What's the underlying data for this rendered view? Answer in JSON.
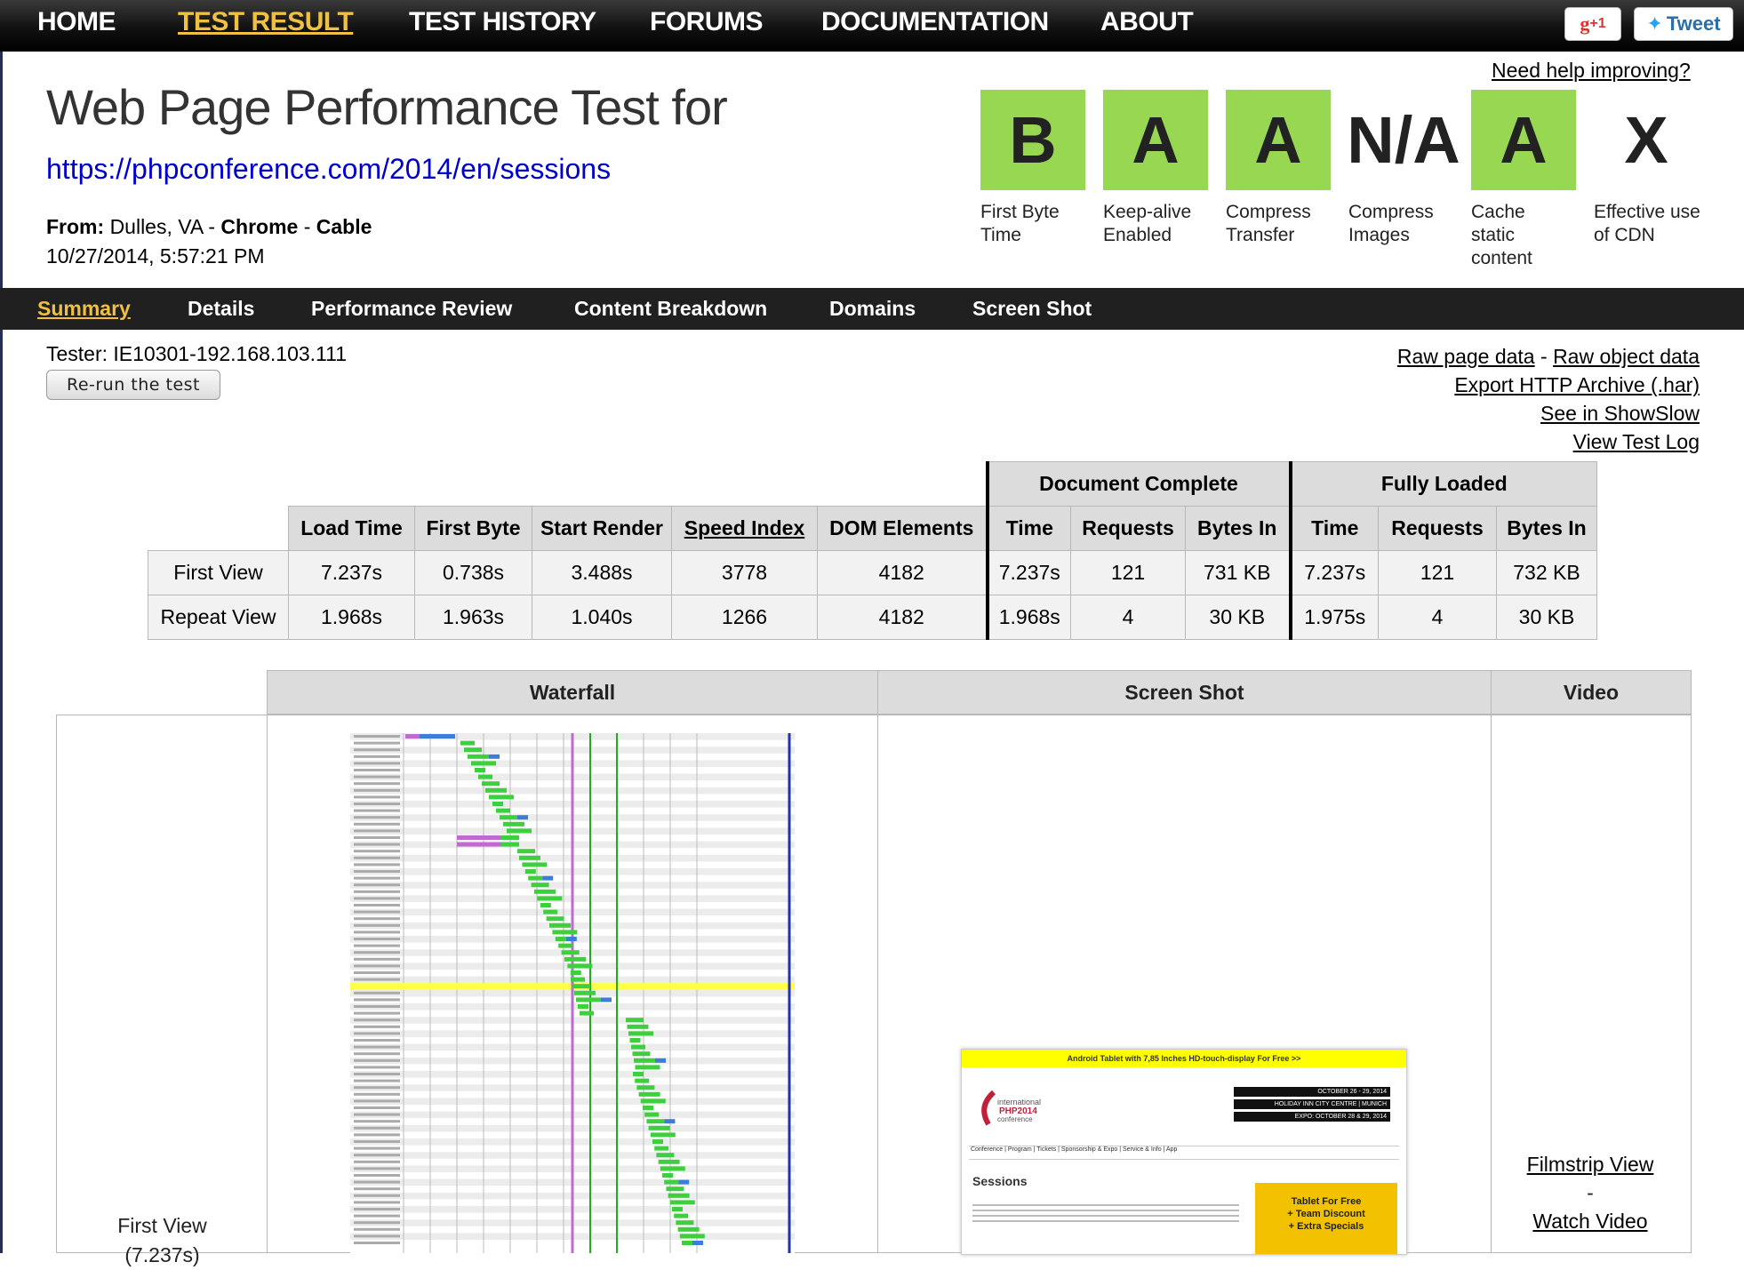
{
  "topnav": {
    "items": [
      "HOME",
      "TEST RESULT",
      "TEST HISTORY",
      "FORUMS",
      "DOCUMENTATION",
      "ABOUT"
    ],
    "gplus": "+1",
    "tweet": "Tweet"
  },
  "need_help": "Need help improving?",
  "header": {
    "title": "Web Page Performance Test for",
    "url": "https://phpconference.com/2014/en/sessions",
    "from_label": "From:",
    "location": "Dulles, VA",
    "browser": "Chrome",
    "connection": "Cable",
    "datetime": "10/27/2014, 5:57:21 PM"
  },
  "grades": [
    {
      "grade": "B",
      "label": "First Byte Time",
      "color": "#97d752"
    },
    {
      "grade": "A",
      "label": "Keep-alive Enabled",
      "color": "#97d752"
    },
    {
      "grade": "A",
      "label": "Compress Transfer",
      "color": "#97d752"
    },
    {
      "grade": "N/A",
      "label": "Compress Images",
      "color": "#ffffff"
    },
    {
      "grade": "A",
      "label": "Cache static content",
      "color": "#97d752"
    },
    {
      "grade": "X",
      "label": "Effective use of CDN",
      "color": "#ffffff"
    }
  ],
  "subnav": [
    "Summary",
    "Details",
    "Performance Review",
    "Content Breakdown",
    "Domains",
    "Screen Shot"
  ],
  "tester": "Tester: IE10301-192.168.103.111",
  "rerun_label": "Re-run the test",
  "links": {
    "raw_page": "Raw page data",
    "sep": "-",
    "raw_object": "Raw object data",
    "har": "Export HTTP Archive (.har)",
    "showslow": "See in ShowSlow",
    "testlog": "View Test Log"
  },
  "results": {
    "group_doc": "Document Complete",
    "group_full": "Fully Loaded",
    "headers": [
      "Load Time",
      "First Byte",
      "Start Render",
      "Speed Index",
      "DOM Elements",
      "Time",
      "Requests",
      "Bytes In",
      "Time",
      "Requests",
      "Bytes In"
    ],
    "rows": [
      {
        "label": "First View",
        "cells": [
          "7.237s",
          "0.738s",
          "3.488s",
          "3778",
          "4182",
          "7.237s",
          "121",
          "731 KB",
          "7.237s",
          "121",
          "732 KB"
        ]
      },
      {
        "label": "Repeat View",
        "cells": [
          "1.968s",
          "1.963s",
          "1.040s",
          "1266",
          "4182",
          "1.968s",
          "4",
          "30 KB",
          "1.975s",
          "4",
          "30 KB"
        ]
      }
    ]
  },
  "bottom": {
    "waterfall": "Waterfall",
    "screenshot": "Screen Shot",
    "video": "Video",
    "fv_label": "First View",
    "fv_time": "(7.237s)",
    "filmstrip": "Filmstrip View",
    "dash": "-",
    "watch_video": "Watch Video"
  },
  "colors": {
    "grade_green": "#97d752",
    "active_nav": "#f0c040",
    "link_blue": "#0000cc"
  }
}
